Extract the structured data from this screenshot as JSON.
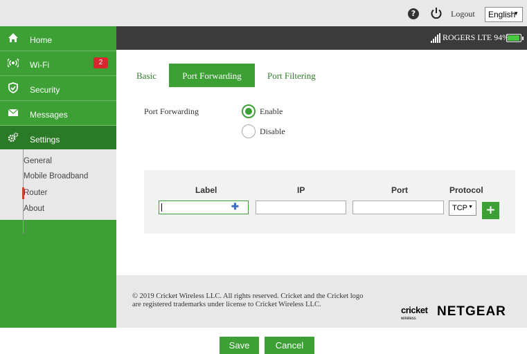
{
  "header": {
    "help_glyph": "?",
    "logout_label": "Logout",
    "language_selected": "English"
  },
  "status": {
    "carrier_text": "ROGERS",
    "network_text": "LTE",
    "battery_text": "94%",
    "battery_level_percent": 94
  },
  "sidebar": {
    "items": [
      {
        "label": "Home",
        "icon": "home-icon"
      },
      {
        "label": "Wi-Fi",
        "icon": "wifi-icon",
        "badge": "2"
      },
      {
        "label": "Security",
        "icon": "shield-icon"
      },
      {
        "label": "Messages",
        "icon": "envelope-icon"
      },
      {
        "label": "Settings",
        "icon": "gear-icon",
        "active": true
      }
    ],
    "submenu": [
      "General",
      "Mobile Broadband",
      "Router",
      "About"
    ],
    "submenu_current": "Router"
  },
  "tabs": [
    {
      "label": "Basic"
    },
    {
      "label": "Port Forwarding",
      "active": true
    },
    {
      "label": "Port Filtering"
    }
  ],
  "port_forwarding": {
    "field_label": "Port Forwarding",
    "enable_label": "Enable",
    "disable_label": "Disable",
    "selected": "Enable"
  },
  "table": {
    "columns": [
      "Label",
      "IP",
      "Port",
      "Protocol"
    ],
    "label_value": "",
    "ip_value": "",
    "port_value": "",
    "protocol_selected": "TCP",
    "add_glyph": "+"
  },
  "footer": {
    "copyright_line1": "© 2019 Cricket Wireless LLC. All rights reserved. Cricket and the Cricket logo",
    "copyright_line2": "are registered trademarks under license to Cricket Wireless LLC.",
    "cricket_logo": "cricket",
    "cricket_sub": "wireless",
    "netgear_logo": "NETGEAR"
  },
  "actions": {
    "save_label": "Save",
    "cancel_label": "Cancel"
  },
  "colors": {
    "brand_green": "#3ca035",
    "active_green": "#2a7a27",
    "status_bar": "#3b3b3b",
    "badge_red": "#d9262f"
  }
}
